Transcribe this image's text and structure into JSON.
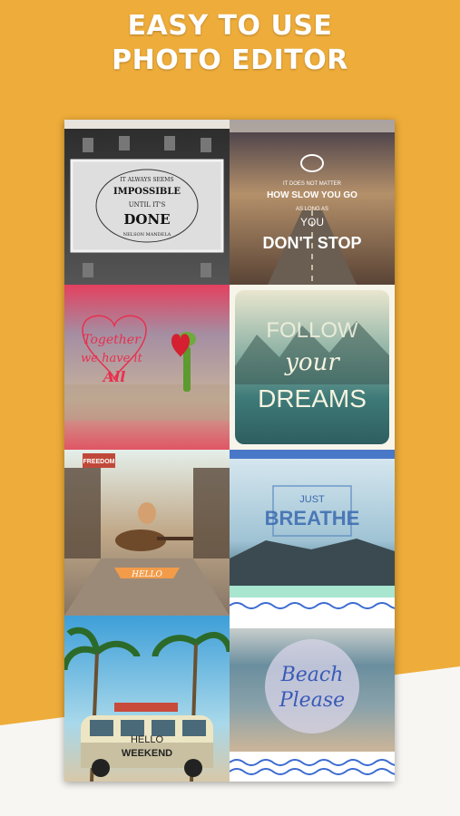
{
  "headline": {
    "line1": "EASY TO USE",
    "line2": "PHOTO EDITOR"
  },
  "tiles": [
    {
      "lines": [
        "IT ALWAYS SEEMS",
        "IMPOSSIBLE",
        "UNTIL IT'S",
        "DONE",
        "NELSON MANDELA"
      ]
    },
    {
      "lines": [
        "IT DOES NOT MATTER",
        "HOW SLOW YOU GO",
        "AS LONG AS",
        "YOU",
        "DON'T STOP"
      ]
    },
    {
      "lines": [
        "Together",
        "we have it",
        "All"
      ]
    },
    {
      "lines": [
        "FOLLOW",
        "your",
        "DREAMS"
      ]
    },
    {
      "lines": [
        "FREEDOM",
        "HELLO"
      ]
    },
    {
      "lines": [
        "JUST",
        "BREATHE"
      ]
    },
    {
      "lines": [
        "HELLO",
        "WEEKEND"
      ]
    },
    {
      "lines": [
        "Beach",
        "Please"
      ]
    }
  ],
  "colors": {
    "background": "#EEAC3A",
    "wedge": "#F7F6F3",
    "headline": "#FFFFFF"
  }
}
